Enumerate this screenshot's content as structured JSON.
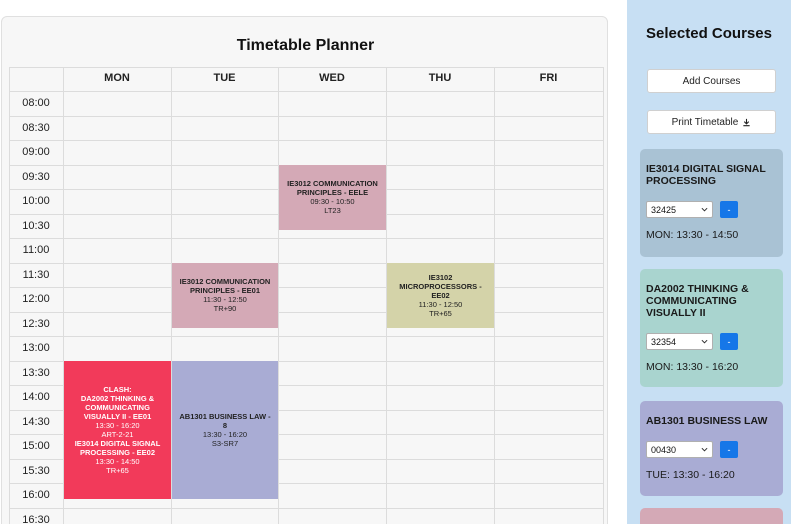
{
  "planner": {
    "title": "Timetable Planner",
    "days": [
      "MON",
      "TUE",
      "WED",
      "THU",
      "FRI"
    ],
    "times": [
      "08:00",
      "08:30",
      "09:00",
      "09:30",
      "10:00",
      "10:30",
      "11:00",
      "11:30",
      "12:00",
      "12:30",
      "13:00",
      "13:30",
      "14:00",
      "14:30",
      "15:00",
      "15:30",
      "16:00",
      "16:30"
    ],
    "slots": [
      {
        "day": "WED",
        "start": "09:30",
        "end": "10:50",
        "color": "#d4a9b6",
        "clash": false,
        "lines": [
          "IE3012 COMMUNICATION PRINCIPLES - EELE",
          "09:30 - 10:50",
          "LT23"
        ]
      },
      {
        "day": "TUE",
        "start": "11:30",
        "end": "12:50",
        "color": "#d4a9b6",
        "clash": false,
        "lines": [
          "IE3012 COMMUNICATION PRINCIPLES - EE01",
          "11:30 - 12:50",
          "TR+90"
        ]
      },
      {
        "day": "THU",
        "start": "11:30",
        "end": "12:50",
        "color": "#d4d3a9",
        "clash": false,
        "lines": [
          "IE3102 MICROPROCESSORS - EE02",
          "11:30 - 12:50",
          "TR+65"
        ]
      },
      {
        "day": "MON",
        "start": "13:30",
        "end": "16:20",
        "color": "#f23a5a",
        "clash": true,
        "lines": [
          "CLASH:",
          "DA2002 THINKING & COMMUNICATING VISUALLY II - EE01",
          "13:30 - 16:20",
          "ART-2-21",
          "IE3014 DIGITAL SIGNAL PROCESSING - EE02",
          "13:30 - 14:50",
          "TR+65"
        ]
      },
      {
        "day": "TUE",
        "start": "13:30",
        "end": "16:20",
        "color": "#a9acd4",
        "clash": false,
        "lines": [
          "AB1301 BUSINESS LAW - 8",
          "13:30 - 16:20",
          "S3-SR7"
        ]
      }
    ]
  },
  "side": {
    "title": "Selected Courses",
    "add_label": "Add Courses",
    "print_label": "Print Timetable",
    "print_icon": "download-icon",
    "courses": [
      {
        "title": "IE3014 DIGITAL SIGNAL PROCESSING",
        "index": "32425",
        "button": "-",
        "time": "MON: 13:30 - 14:50",
        "color": "#a9c2d4"
      },
      {
        "title": "DA2002 THINKING & COMMUNICATING VISUALLY II",
        "index": "32354",
        "button": "-",
        "time": "MON: 13:30 - 16:20",
        "color": "#a9d4cf"
      },
      {
        "title": "AB1301 BUSINESS LAW",
        "index": "00430",
        "button": "-",
        "time": "TUE: 13:30 - 16:20",
        "color": "#a9acd4"
      },
      {
        "title": "",
        "index": "",
        "button": "",
        "time": "",
        "color": "#d4a9b6"
      }
    ]
  }
}
